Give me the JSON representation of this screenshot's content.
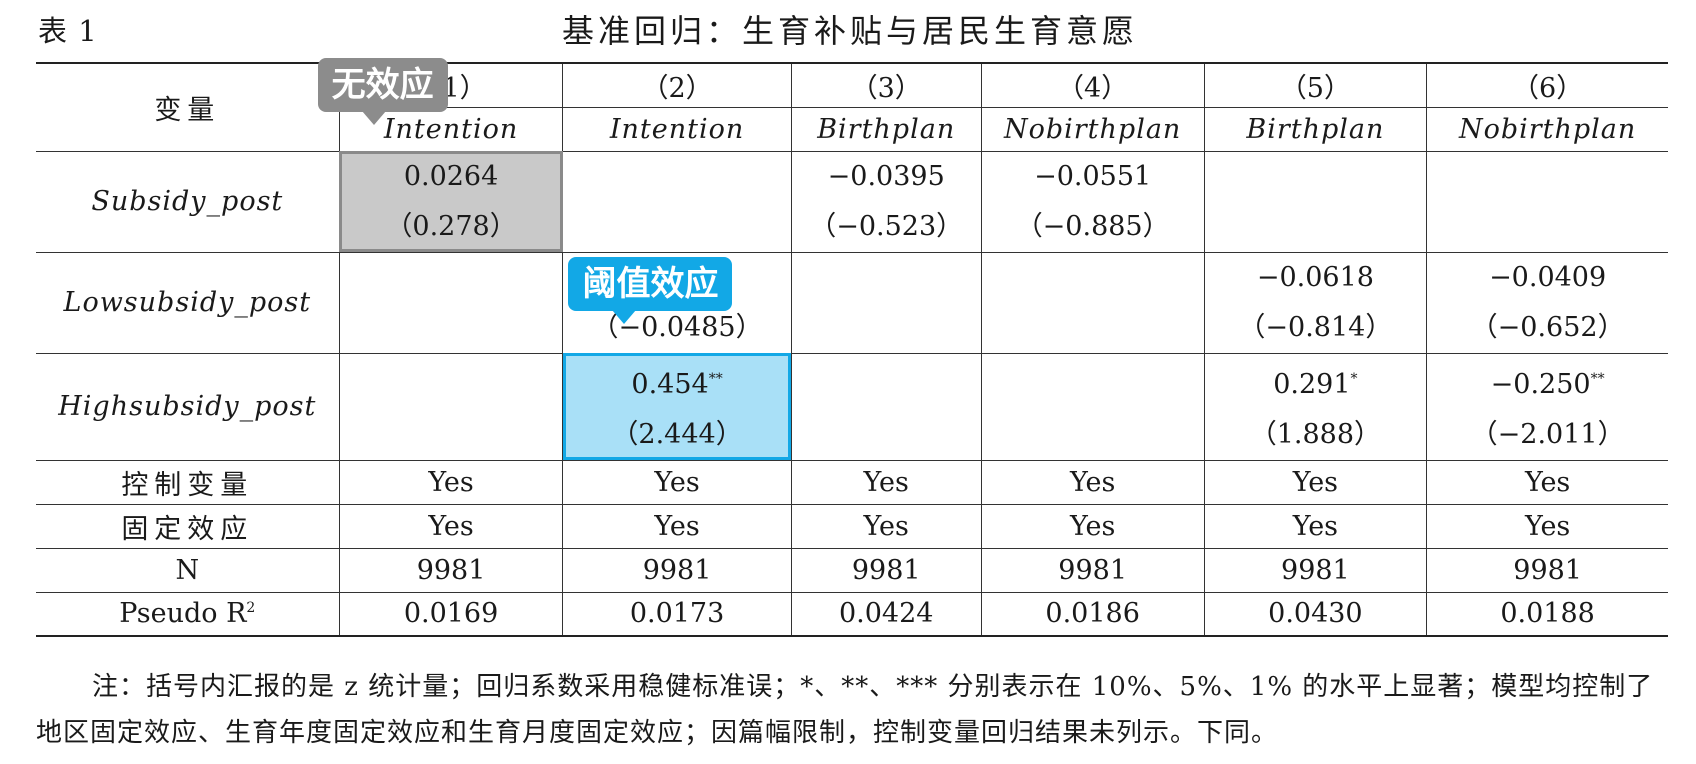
{
  "table_label": "表 1",
  "title": "基准回归：生育补贴与居民生育意愿",
  "header": {
    "variable_label": "变量",
    "columns": [
      "（1）",
      "（2）",
      "（3）",
      "（4）",
      "（5）",
      "（6）"
    ],
    "dep_vars": [
      "Intention",
      "Intention",
      "Birthplan",
      "Nobirthplan",
      "Birthplan",
      "Nobirthplan"
    ]
  },
  "rows": {
    "subsidy_post": {
      "name": "Subsidy_post",
      "c1": "0.0264",
      "c1_t": "（0.278）",
      "c3": "−0.0395",
      "c3_t": "（−0.523）",
      "c4": "−0.0551",
      "c4_t": "（−0.885）"
    },
    "lowsubsidy_post": {
      "name": "Lowsubsidy_post",
      "c2_t": "（−0.0485）",
      "c5": "−0.0618",
      "c5_t": "（−0.814）",
      "c6": "−0.0409",
      "c6_t": "（−0.652）"
    },
    "highsubsidy_post": {
      "name": "Highsubsidy_post",
      "c2": "0.454",
      "c2_sig": "**",
      "c2_t": "（2.444）",
      "c5": "0.291",
      "c5_sig": "*",
      "c5_t": "（1.888）",
      "c6": "−0.250",
      "c6_sig": "**",
      "c6_t": "（−2.011）"
    },
    "controls": {
      "name": "控制变量",
      "values": [
        "Yes",
        "Yes",
        "Yes",
        "Yes",
        "Yes",
        "Yes"
      ]
    },
    "fixed_effects": {
      "name": "固定效应",
      "values": [
        "Yes",
        "Yes",
        "Yes",
        "Yes",
        "Yes",
        "Yes"
      ]
    },
    "n": {
      "name": "N",
      "values": [
        "9981",
        "9981",
        "9981",
        "9981",
        "9981",
        "9981"
      ]
    },
    "pseudo_r2": {
      "name": "Pseudo R",
      "sup": "2",
      "values": [
        "0.0169",
        "0.0173",
        "0.0424",
        "0.0186",
        "0.0430",
        "0.0188"
      ]
    }
  },
  "annotations": {
    "no_effect": "无效应",
    "threshold_effect": "阈值效应"
  },
  "note": "注：括号内汇报的是 z 统计量；回归系数采用稳健标准误；*、**、*** 分别表示在 10%、5%、1% 的水平上显著；模型均控制了地区固定效应、生育年度固定效应和生育月度固定效应；因篇幅限制，控制变量回归结果未列示。下同。",
  "colors": {
    "gray_highlight": "#c9c9c9",
    "blue_highlight": "#a9e0f7",
    "blue_tag": "#12a8e6",
    "gray_tag": "#8c8c8c"
  }
}
